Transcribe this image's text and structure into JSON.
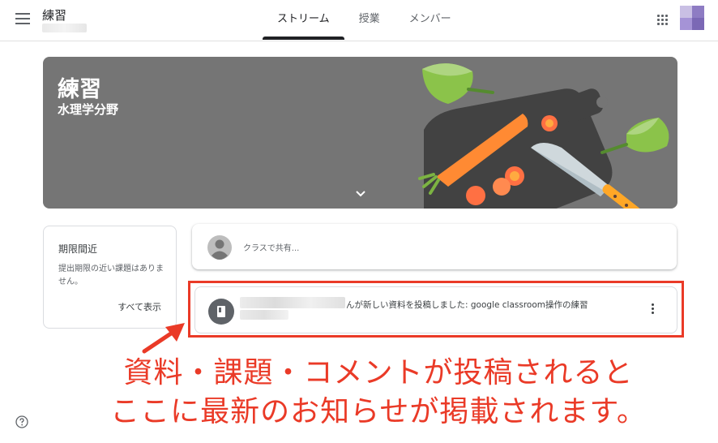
{
  "header": {
    "menu_icon": "hamburger-menu-icon",
    "class_title": "練習",
    "tabs": [
      {
        "label": "ストリーム",
        "active": true
      },
      {
        "label": "授業",
        "active": false
      },
      {
        "label": "メンバー",
        "active": false
      }
    ],
    "apps_icon": "apps-grid-icon",
    "account_icon": "account-avatar"
  },
  "banner": {
    "title": "練習",
    "subtitle": "水理学分野",
    "background_color": "#757575",
    "expand_icon": "chevron-down-icon"
  },
  "upcoming": {
    "title": "期限間近",
    "body": "提出期限の近い課題はありません。",
    "view_all": "すべて表示"
  },
  "share": {
    "placeholder": "クラスで共有..."
  },
  "post": {
    "text": "んが新しい資料を投稿しました: google classroom操作の練習",
    "icon": "material-book-icon",
    "menu_icon": "more-vert-icon"
  },
  "annotation": {
    "line1": "資料・課題・コメントが投稿されると",
    "line2": "ここに最新のお知らせが掲載されます。",
    "color": "#ea3a27"
  },
  "footer": {
    "help_icon": "help-icon"
  }
}
